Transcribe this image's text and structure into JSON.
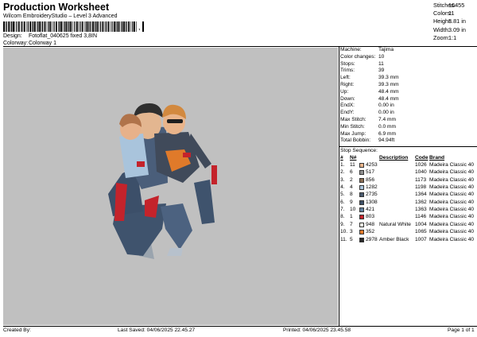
{
  "header": {
    "title": "Production Worksheet",
    "subtitle": "Wilcom EmbroideryStudio – Level 3 Advanced",
    "barcode_suffix": ","
  },
  "meta": {
    "design_label": "Design:",
    "design_value": "Fotoflat_040625 fixed 3,8IN",
    "colorway_label": "Colorway:",
    "colorway_value": "Colorway 1"
  },
  "stats": [
    {
      "label": "Stitches:",
      "value": "16455"
    },
    {
      "label": "Colors:",
      "value": "11"
    },
    {
      "label": "Height:",
      "value": "3.81 in"
    },
    {
      "label": "Width:",
      "value": "3.09 in"
    },
    {
      "label": "Zoom:",
      "value": "1:1"
    }
  ],
  "info": [
    {
      "label": "Machine:",
      "value": "Tajima"
    },
    {
      "label": "Color changes:",
      "value": "10"
    },
    {
      "label": "Stops:",
      "value": "11"
    },
    {
      "label": "Trims:",
      "value": "39"
    },
    {
      "label": "Left:",
      "value": "39.3 mm"
    },
    {
      "label": "Right:",
      "value": "39.3 mm"
    },
    {
      "label": "Up:",
      "value": "48.4 mm"
    },
    {
      "label": "Down:",
      "value": "48.4 mm"
    },
    {
      "label": "EndX:",
      "value": "0.00 in"
    },
    {
      "label": "EndY:",
      "value": "0.00 in"
    },
    {
      "label": "Max Stitch:",
      "value": "7.4 mm"
    },
    {
      "label": "Min Stitch:",
      "value": "0.0 mm"
    },
    {
      "label": "Max Jump:",
      "value": "6.9 mm"
    },
    {
      "label": "Total Bobbin:",
      "value": "94.94ft"
    }
  ],
  "stop_sequence": {
    "title": "Stop Sequence:",
    "headers": {
      "num": "#",
      "n": "N#",
      "no": "",
      "desc": "Description",
      "code": "Code",
      "brand": "Brand"
    },
    "rows": [
      {
        "num": "1.",
        "n": "11",
        "color": "#e9b48a",
        "no": "4253",
        "desc": "",
        "code": "1026",
        "brand": "Madeira Classic 40"
      },
      {
        "num": "2.",
        "n": "6",
        "color": "#8f8f8f",
        "no": "517",
        "desc": "",
        "code": "1040",
        "brand": "Madeira Classic 40"
      },
      {
        "num": "3.",
        "n": "2",
        "color": "#8a6e55",
        "no": "856",
        "desc": "",
        "code": "1173",
        "brand": "Madeira Classic 40"
      },
      {
        "num": "4.",
        "n": "4",
        "color": "#a9c4dc",
        "no": "1282",
        "desc": "",
        "code": "1198",
        "brand": "Madeira Classic 40"
      },
      {
        "num": "5.",
        "n": "8",
        "color": "#4a5a6e",
        "no": "2735",
        "desc": "",
        "code": "1364",
        "brand": "Madeira Classic 40"
      },
      {
        "num": "6.",
        "n": "9",
        "color": "#3d4f66",
        "no": "1308",
        "desc": "",
        "code": "1362",
        "brand": "Madeira Classic 40"
      },
      {
        "num": "7.",
        "n": "10",
        "color": "#5f7f9e",
        "no": "421",
        "desc": "",
        "code": "1363",
        "brand": "Madeira Classic 40"
      },
      {
        "num": "8.",
        "n": "1",
        "color": "#c4232b",
        "no": "803",
        "desc": "",
        "code": "1146",
        "brand": "Madeira Classic 40"
      },
      {
        "num": "9.",
        "n": "7",
        "color": "#f4f1e6",
        "no": "948",
        "desc": "Natural White",
        "code": "1004",
        "brand": "Madeira Classic 40"
      },
      {
        "num": "10.",
        "n": "3",
        "color": "#e07a2a",
        "no": "352",
        "desc": "",
        "code": "1065",
        "brand": "Madeira Classic 40"
      },
      {
        "num": "11.",
        "n": "5",
        "color": "#2a2a2a",
        "no": "2978",
        "desc": "Amber Black",
        "code": "1007",
        "brand": "Madeira Classic 40"
      }
    ]
  },
  "footer": {
    "created": "Created By:",
    "saved": "Last Saved: 04/06/2025 22.45.27",
    "printed": "Printed: 04/06/2025 23.45.58",
    "page": "Page 1 of 1"
  }
}
